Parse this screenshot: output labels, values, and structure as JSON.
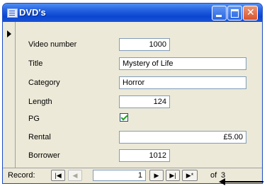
{
  "window": {
    "title": "DVD's",
    "close_symbol": "✕"
  },
  "form": {
    "fields": [
      {
        "label": "Video number",
        "value": "1000"
      },
      {
        "label": "Title",
        "value": "Mystery of Life"
      },
      {
        "label": "Category",
        "value": "Horror"
      },
      {
        "label": "Length",
        "value": "124"
      },
      {
        "label": "PG",
        "checked": true
      },
      {
        "label": "Rental",
        "value": "£5.00"
      },
      {
        "label": "Borrower",
        "value": "1012"
      }
    ]
  },
  "navigation": {
    "label": "Record:",
    "first": "|◀",
    "prev": "◀",
    "current": "1",
    "next": "▶",
    "last": "▶|",
    "new": "▶*",
    "of": "of",
    "total": "3"
  },
  "icons": {
    "window_icon": "table-icon",
    "record_selector": "record-pointer-icon",
    "annotation": "arrow-left-icon"
  }
}
